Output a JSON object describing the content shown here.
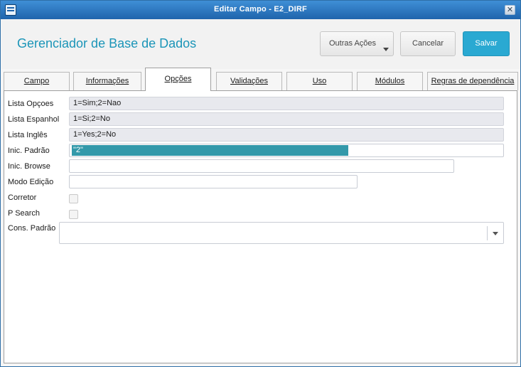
{
  "window": {
    "title": "Editar Campo - E2_DIRF",
    "close_glyph": "✕"
  },
  "header": {
    "title": "Gerenciador de Base de Dados",
    "actions": {
      "outras": "Outras Ações",
      "cancel": "Cancelar",
      "save": "Salvar"
    }
  },
  "tabs": [
    {
      "label": "Campo",
      "active": false
    },
    {
      "label": "Informações",
      "active": false
    },
    {
      "label": "Opções",
      "active": true
    },
    {
      "label": "Validações",
      "active": false
    },
    {
      "label": "Uso",
      "active": false
    },
    {
      "label": "Módulos",
      "active": false
    },
    {
      "label": "Regras de dependência",
      "active": false
    }
  ],
  "form": {
    "lista_opcoes": {
      "label": "Lista Opçoes",
      "value": "1=Sim;2=Nao"
    },
    "lista_espanhol": {
      "label": "Lista Espanhol",
      "value": "1=Si;2=No"
    },
    "lista_ingles": {
      "label": "Lista Inglês",
      "value": "1=Yes;2=No"
    },
    "inic_padrao": {
      "label": "Inic. Padrão",
      "value": "\"2\""
    },
    "inic_browse": {
      "label": "Inic. Browse",
      "value": ""
    },
    "modo_edicao": {
      "label": "Modo Edição",
      "value": ""
    },
    "corretor": {
      "label": "Corretor",
      "checked": false
    },
    "p_search": {
      "label": "P Search",
      "checked": false
    },
    "cons_padrao": {
      "label": "Cons. Padrão",
      "value": ""
    }
  },
  "colors": {
    "accent": "#1b95b8",
    "save_button": "#2aa9d2",
    "titlebar": "#2a75bf",
    "selection": "#3399aa"
  },
  "icons": {
    "app": "window-icon",
    "close": "close-icon",
    "dropdown": "chevron-down-icon"
  }
}
